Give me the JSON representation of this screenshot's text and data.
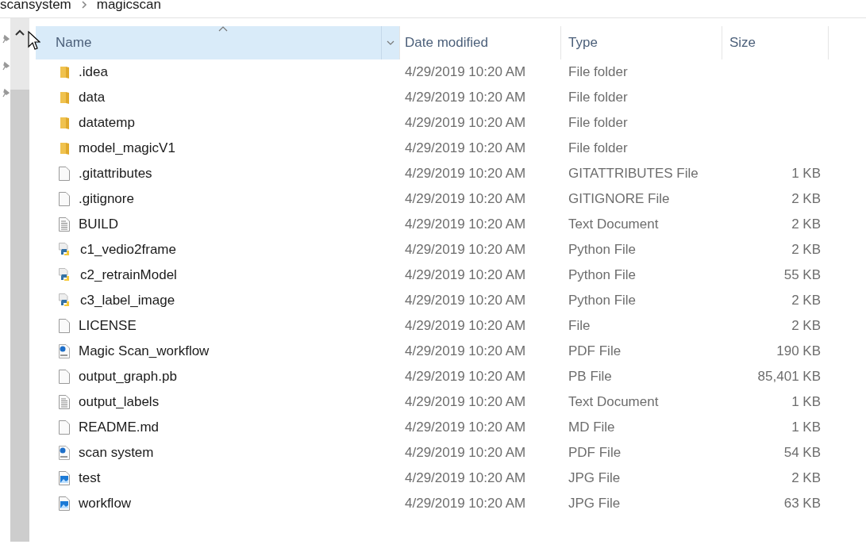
{
  "breadcrumb": [
    "scansystem",
    "magicscan"
  ],
  "columns": [
    {
      "label": "Name",
      "selected": true
    },
    {
      "label": "Date modified",
      "selected": false
    },
    {
      "label": "Type",
      "selected": false
    },
    {
      "label": "Size",
      "selected": false
    }
  ],
  "rows": [
    {
      "name": ".idea",
      "date": "4/29/2019 10:20 AM",
      "type": "File folder",
      "kind": "folder"
    },
    {
      "name": "data",
      "date": "4/29/2019 10:20 AM",
      "type": "File folder",
      "kind": "folder"
    },
    {
      "name": "datatemp",
      "date": "4/29/2019 10:20 AM",
      "type": "File folder",
      "kind": "folder"
    },
    {
      "name": "model_magicV1",
      "date": "4/29/2019 10:20 AM",
      "type": "File folder",
      "kind": "folder"
    },
    {
      "name": ".gitattributes",
      "date": "4/29/2019 10:20 AM",
      "type": "GITATTRIBUTES File",
      "size": "1 KB",
      "kind": "blank"
    },
    {
      "name": ".gitignore",
      "date": "4/29/2019 10:20 AM",
      "type": "GITIGNORE File",
      "size": "2 KB",
      "kind": "blank"
    },
    {
      "name": "BUILD",
      "date": "4/29/2019 10:20 AM",
      "type": "Text Document",
      "size": "2 KB",
      "kind": "text"
    },
    {
      "name": "c1_vedio2frame",
      "date": "4/29/2019 10:20 AM",
      "type": "Python File",
      "size": "2 KB",
      "kind": "python"
    },
    {
      "name": "c2_retrainModel",
      "date": "4/29/2019 10:20 AM",
      "type": "Python File",
      "size": "55 KB",
      "kind": "python"
    },
    {
      "name": "c3_label_image",
      "date": "4/29/2019 10:20 AM",
      "type": "Python File",
      "size": "2 KB",
      "kind": "python"
    },
    {
      "name": "LICENSE",
      "date": "4/29/2019 10:20 AM",
      "type": "File",
      "size": "2 KB",
      "kind": "blank"
    },
    {
      "name": "Magic Scan_workflow",
      "date": "4/29/2019 10:20 AM",
      "type": "PDF File",
      "size": "190 KB",
      "kind": "pdf"
    },
    {
      "name": "output_graph.pb",
      "date": "4/29/2019 10:20 AM",
      "type": "PB File",
      "size": "85,401 KB",
      "kind": "blank"
    },
    {
      "name": "output_labels",
      "date": "4/29/2019 10:20 AM",
      "type": "Text Document",
      "size": "1 KB",
      "kind": "text"
    },
    {
      "name": "README.md",
      "date": "4/29/2019 10:20 AM",
      "type": "MD File",
      "size": "1 KB",
      "kind": "blank"
    },
    {
      "name": "scan system",
      "date": "4/29/2019 10:20 AM",
      "type": "PDF File",
      "size": "54 KB",
      "kind": "pdf"
    },
    {
      "name": "test",
      "date": "4/29/2019 10:20 AM",
      "type": "JPG File",
      "size": "2 KB",
      "kind": "image"
    },
    {
      "name": "workflow",
      "date": "4/29/2019 10:20 AM",
      "type": "JPG File",
      "size": "63 KB",
      "kind": "image"
    }
  ]
}
